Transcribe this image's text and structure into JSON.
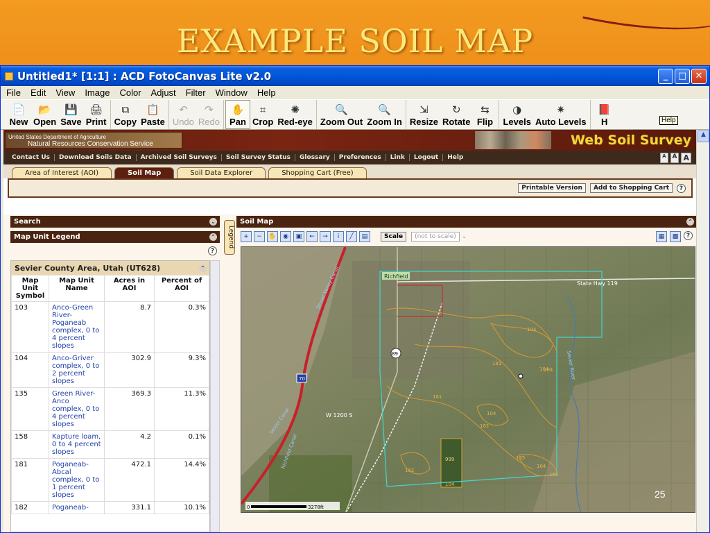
{
  "slide": {
    "title": "EXAMPLE SOIL MAP",
    "page_number": "25"
  },
  "window": {
    "title": "Untitled1* [1:1] : ACD FotoCanvas Lite v2.0",
    "buttons": [
      "_",
      "□",
      "✕"
    ]
  },
  "menu": [
    "File",
    "Edit",
    "View",
    "Image",
    "Color",
    "Adjust",
    "Filter",
    "Window",
    "Help"
  ],
  "toolbar": {
    "groups": [
      [
        {
          "label": "New",
          "icon": "📄"
        },
        {
          "label": "Open",
          "icon": "📂"
        },
        {
          "label": "Save",
          "icon": "💾"
        },
        {
          "label": "Print",
          "icon": "🖨"
        }
      ],
      [
        {
          "label": "Copy",
          "icon": "⧉"
        },
        {
          "label": "Paste",
          "icon": "📋"
        }
      ],
      [
        {
          "label": "Undo",
          "icon": "↶",
          "disabled": true
        },
        {
          "label": "Redo",
          "icon": "↷",
          "disabled": true
        }
      ],
      [
        {
          "label": "Pan",
          "icon": "✋",
          "active": true
        },
        {
          "label": "Crop",
          "icon": "⌗"
        },
        {
          "label": "Red-eye",
          "icon": "✺"
        }
      ],
      [
        {
          "label": "Zoom Out",
          "icon": "🔍"
        },
        {
          "label": "Zoom In",
          "icon": "🔍"
        }
      ],
      [
        {
          "label": "Resize",
          "icon": "⇲"
        },
        {
          "label": "Rotate",
          "icon": "↻"
        },
        {
          "label": "Flip",
          "icon": "⇆"
        }
      ],
      [
        {
          "label": "Levels",
          "icon": "◑"
        },
        {
          "label": "Auto Levels",
          "icon": "✷"
        }
      ],
      [
        {
          "label": "H",
          "icon": "📕"
        }
      ]
    ],
    "tooltip": "Help"
  },
  "wss": {
    "usda_line1": "United States Department of Agriculture",
    "usda_line2": "Natural Resources Conservation Service",
    "logo": "Web Soil Survey",
    "nav": [
      "Contact Us",
      "Download Soils Data",
      "Archived Soil Surveys",
      "Soil Survey Status",
      "Glossary",
      "Preferences",
      "Link",
      "Logout",
      "Help"
    ],
    "font_sizes": [
      "A",
      "A",
      "A"
    ],
    "tabs": [
      "Area of Interest (AOI)",
      "Soil Map",
      "Soil Data Explorer",
      "Shopping Cart (Free)"
    ],
    "active_tab": "Soil Map",
    "actions": [
      "Printable Version",
      "Add to Shopping Cart"
    ],
    "search_label": "Search",
    "legend_label": "Map Unit Legend",
    "legend_tab": "Legend",
    "area_title": "Sevier County Area, Utah (UT628)",
    "columns": [
      "Map Unit Symbol",
      "Map Unit Name",
      "Acres in AOI",
      "Percent of AOI"
    ],
    "rows": [
      {
        "symbol": "103",
        "name": "Anco-Green River-Poganeab complex, 0 to 4 percent slopes",
        "acres": "8.7",
        "percent": "0.3%"
      },
      {
        "symbol": "104",
        "name": "Anco-Griver complex, 0 to 2 percent slopes",
        "acres": "302.9",
        "percent": "9.3%"
      },
      {
        "symbol": "135",
        "name": "Green River-Anco complex, 0 to 4 percent slopes",
        "acres": "369.3",
        "percent": "11.3%"
      },
      {
        "symbol": "158",
        "name": "Kapture loam, 0 to 4 percent slopes",
        "acres": "4.2",
        "percent": "0.1%"
      },
      {
        "symbol": "181",
        "name": "Poganeab-Abcal complex, 0 to 1 percent slopes",
        "acres": "472.1",
        "percent": "14.4%"
      },
      {
        "symbol": "182",
        "name": "Poganeab-",
        "acres": "331.1",
        "percent": "10.1%"
      }
    ],
    "map_panel_title": "Soil Map",
    "scale_label": "Scale",
    "scale_value": "(not to scale)",
    "map_labels": {
      "town": "Richfield",
      "highway": "State Hwy 119",
      "street": "W 1200 S",
      "river": "Sevier River",
      "canal1": "Sevier Valley Canal",
      "canal2": "Sevier Canal",
      "canal3": "Richfield Canal",
      "interstate": "70",
      "us_route": "89",
      "scale_bar_start": "0",
      "scale_bar_end": "3278ft"
    },
    "map_unit_labels": [
      "104",
      "181",
      "104",
      "104",
      "182",
      "181",
      "104",
      "999",
      "135",
      "104",
      "103",
      "104",
      "182"
    ]
  }
}
